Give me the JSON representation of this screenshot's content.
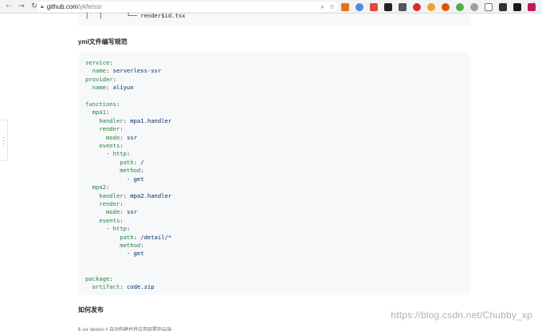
{
  "browser": {
    "url_host": "github.com",
    "url_path": "/ykfe/ssr"
  },
  "colors": {
    "code_key": "#22863a",
    "code_value": "#032f62",
    "code_bg": "#f6f8fa"
  },
  "page": {
    "tree_fragment": "│   │       └── render$id.tsx",
    "heading_yml": "yml文件编写规范",
    "heading_publish": "如何发布",
    "bottom_partial": "$ ssr deploy  # 自动构建并将应用部署到云端"
  },
  "code_lines": [
    {
      "indent": "",
      "key": "service",
      "sep": ":",
      "value": ""
    },
    {
      "indent": "  ",
      "key": "name",
      "sep": ": ",
      "value": "serverless-ssr"
    },
    {
      "indent": "",
      "key": "provider",
      "sep": ":",
      "value": ""
    },
    {
      "indent": "  ",
      "key": "name",
      "sep": ": ",
      "value": "aliyun"
    },
    {
      "indent": "",
      "key": "",
      "sep": "",
      "value": ""
    },
    {
      "indent": "",
      "key": "functions",
      "sep": ":",
      "value": ""
    },
    {
      "indent": "  ",
      "key": "mpa1",
      "sep": ":",
      "value": ""
    },
    {
      "indent": "    ",
      "key": "handler",
      "sep": ": ",
      "value": "mpa1.handler"
    },
    {
      "indent": "    ",
      "key": "render",
      "sep": ":",
      "value": ""
    },
    {
      "indent": "      ",
      "key": "mode",
      "sep": ": ",
      "value": "ssr"
    },
    {
      "indent": "    ",
      "key": "events",
      "sep": ":",
      "value": ""
    },
    {
      "indent": "      - ",
      "key": "http",
      "sep": ":",
      "value": ""
    },
    {
      "indent": "          ",
      "key": "path",
      "sep": ": ",
      "value": "/"
    },
    {
      "indent": "          ",
      "key": "method",
      "sep": ":",
      "value": ""
    },
    {
      "indent": "            - ",
      "key": "",
      "sep": "",
      "value": "get"
    },
    {
      "indent": "  ",
      "key": "mpa2",
      "sep": ":",
      "value": ""
    },
    {
      "indent": "    ",
      "key": "handler",
      "sep": ": ",
      "value": "mpa2.handler"
    },
    {
      "indent": "    ",
      "key": "render",
      "sep": ":",
      "value": ""
    },
    {
      "indent": "      ",
      "key": "mode",
      "sep": ": ",
      "value": "ssr"
    },
    {
      "indent": "    ",
      "key": "events",
      "sep": ":",
      "value": ""
    },
    {
      "indent": "      - ",
      "key": "http",
      "sep": ":",
      "value": ""
    },
    {
      "indent": "          ",
      "key": "path",
      "sep": ": ",
      "value": "/detail/*"
    },
    {
      "indent": "          ",
      "key": "method",
      "sep": ":",
      "value": ""
    },
    {
      "indent": "            - ",
      "key": "",
      "sep": "",
      "value": "get"
    },
    {
      "indent": "",
      "key": "",
      "sep": "",
      "value": ""
    },
    {
      "indent": "",
      "key": "",
      "sep": "",
      "value": ""
    },
    {
      "indent": "",
      "key": "package",
      "sep": ":",
      "value": ""
    },
    {
      "indent": "  ",
      "key": "artifact",
      "sep": ": ",
      "value": "code.zip"
    }
  ],
  "watermark": "https://blog.csdn.net/Chubby_xp"
}
